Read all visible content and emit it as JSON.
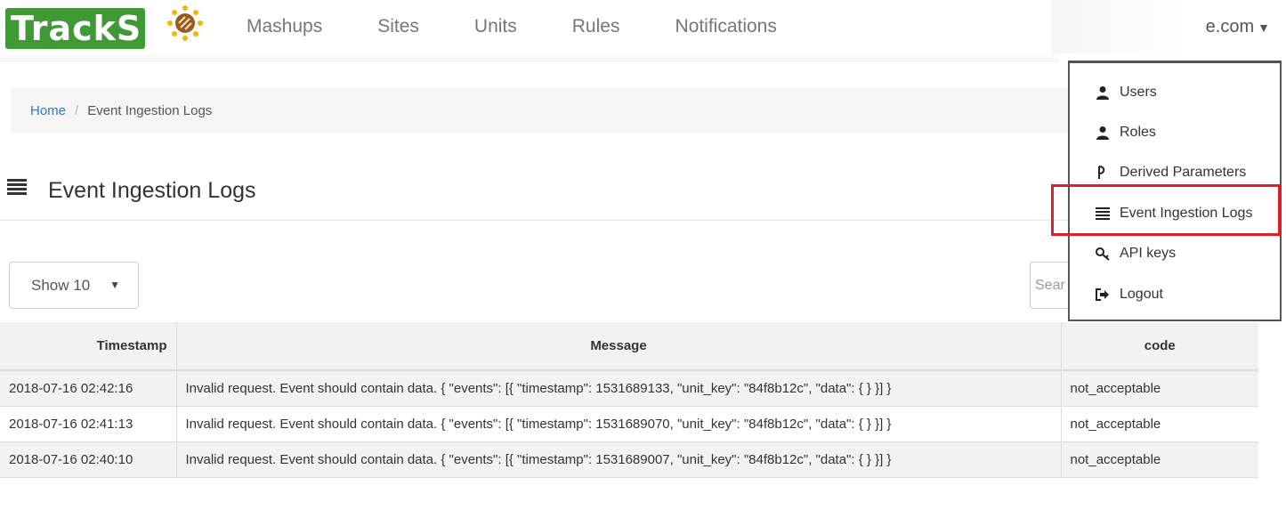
{
  "logo": {
    "text": "TrackS"
  },
  "nav": {
    "items": [
      {
        "label": "Mashups"
      },
      {
        "label": "Sites"
      },
      {
        "label": "Units"
      },
      {
        "label": "Rules"
      },
      {
        "label": "Notifications"
      }
    ]
  },
  "user": {
    "email_visible": "e.com",
    "caret": "▼"
  },
  "dropdown": {
    "items": [
      {
        "label": "Users",
        "icon": "user-icon"
      },
      {
        "label": "Roles",
        "icon": "user-icon"
      },
      {
        "label": "Derived Parameters",
        "icon": "fork-icon"
      },
      {
        "label": "Event Ingestion Logs",
        "icon": "list-icon",
        "highlighted": true
      },
      {
        "label": "API keys",
        "icon": "key-icon"
      },
      {
        "label": "Logout",
        "icon": "logout-icon"
      }
    ]
  },
  "breadcrumb": {
    "home": "Home",
    "separator": "/",
    "current": "Event Ingestion Logs"
  },
  "page": {
    "title": "Event Ingestion Logs"
  },
  "table_controls": {
    "length_label": "Show 10",
    "search_placeholder": "Sear"
  },
  "table": {
    "columns": [
      "Timestamp",
      "Message",
      "code"
    ],
    "rows": [
      {
        "timestamp": "2018-07-16 02:42:16",
        "message": "Invalid request. Event should contain data. { \"events\": [{ \"timestamp\": 1531689133, \"unit_key\": \"84f8b12c\", \"data\": { } }] }",
        "code": "not_acceptable"
      },
      {
        "timestamp": "2018-07-16 02:41:13",
        "message": "Invalid request. Event should contain data. { \"events\": [{ \"timestamp\": 1531689070, \"unit_key\": \"84f8b12c\", \"data\": { } }] }",
        "code": "not_acceptable"
      },
      {
        "timestamp": "2018-07-16 02:40:10",
        "message": "Invalid request. Event should contain data. { \"events\": [{ \"timestamp\": 1531689007, \"unit_key\": \"84f8b12c\", \"data\": { } }] }",
        "code": "not_acceptable"
      }
    ]
  },
  "colors": {
    "logo_green": "#3f9a36",
    "link_blue": "#337ab7",
    "highlight_red": "#e01e2b"
  }
}
